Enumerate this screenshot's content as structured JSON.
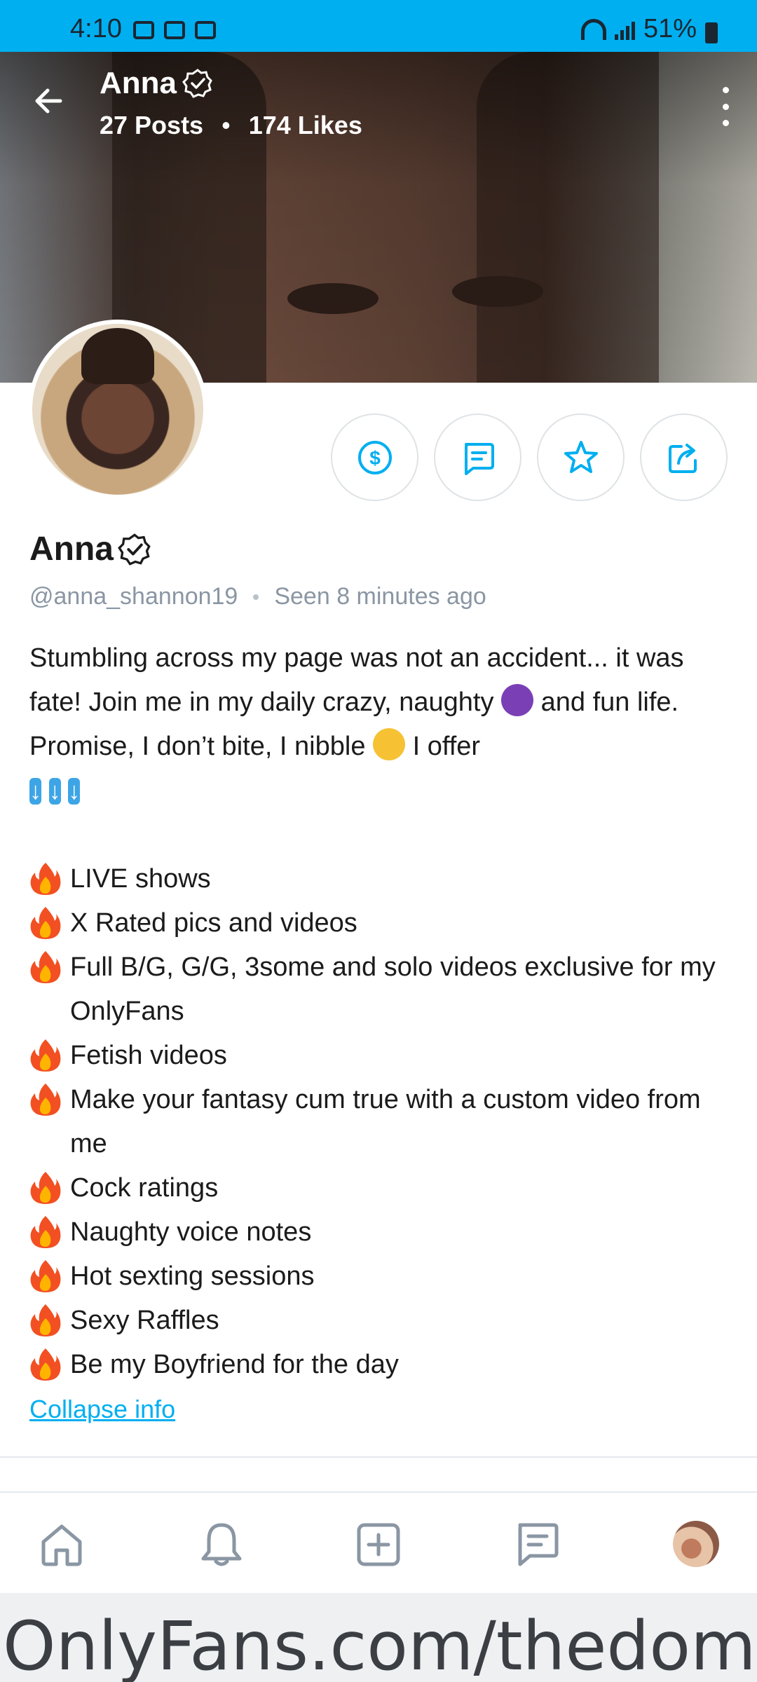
{
  "status_bar": {
    "time": "4:10",
    "battery": "51%"
  },
  "header": {
    "name": "Anna",
    "posts": "27 Posts",
    "likes": "174 Likes",
    "separator": "•"
  },
  "profile": {
    "name": "Anna",
    "handle": "@anna_shannon19",
    "seen": "Seen 8 minutes ago"
  },
  "bio": {
    "intro_1": "Stumbling across my page was not an accident... it was fate! Join me in my daily crazy, naughty",
    "intro_2": "and fun life. Promise, I don’t bite, I nibble",
    "intro_3": "I offer",
    "arrow_glyph": "↓",
    "offers": [
      "LIVE shows",
      "X Rated pics and videos",
      "Full B/G, G/G, 3some and solo videos exclusive for my OnlyFans",
      "Fetish videos",
      "Make your fantasy cum true with a custom video from me",
      "Cock ratings",
      "Naughty voice notes",
      "Hot sexting sessions",
      "Sexy Raffles",
      "Be my Boyfriend for the day"
    ],
    "collapse_label": "Collapse info"
  },
  "actions": [
    "tip-icon",
    "message-icon",
    "favorite-icon",
    "share-icon"
  ],
  "bottom_nav": [
    "home-icon",
    "notifications-icon",
    "add-post-icon",
    "messages-icon",
    "profile-avatar"
  ],
  "watermark": "OnlyFans.com/thedomino",
  "colors": {
    "accent": "#00aff0",
    "muted": "#8a96a3",
    "border": "#dfe3e6"
  }
}
